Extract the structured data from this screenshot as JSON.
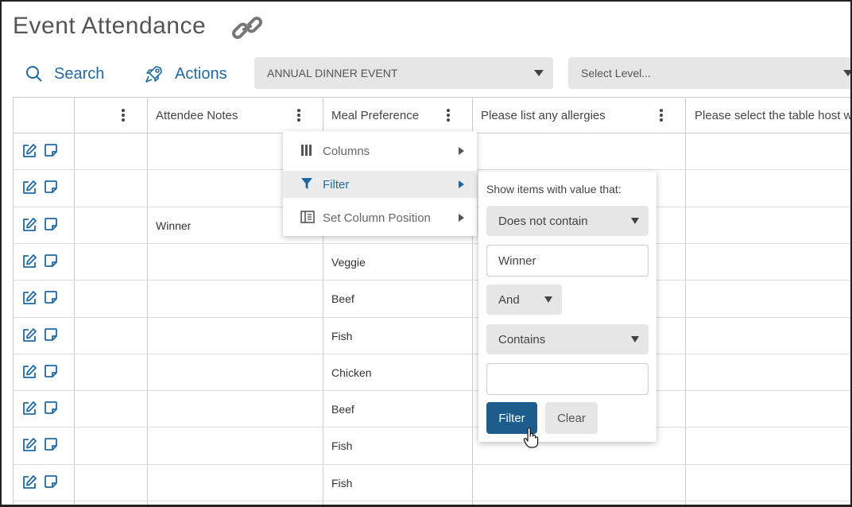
{
  "page": {
    "title": "Event Attendance"
  },
  "toolbar": {
    "search_label": "Search",
    "actions_label": "Actions",
    "event_select_value": "ANNUAL DINNER EVENT",
    "level_select_placeholder": "Select Level..."
  },
  "table": {
    "headers": [
      "",
      "Attendee Notes",
      "Meal Preference",
      "Please list any allergies",
      "Please select the table host w"
    ],
    "rows": [
      {
        "notes": "",
        "meal": ""
      },
      {
        "notes": "",
        "meal": ""
      },
      {
        "notes": "Winner",
        "meal": ""
      },
      {
        "notes": "",
        "meal": "Veggie"
      },
      {
        "notes": "",
        "meal": "Beef"
      },
      {
        "notes": "",
        "meal": "Fish"
      },
      {
        "notes": "",
        "meal": "Chicken"
      },
      {
        "notes": "",
        "meal": "Beef"
      },
      {
        "notes": "",
        "meal": "Fish"
      },
      {
        "notes": "",
        "meal": "Fish"
      }
    ]
  },
  "column_menu": {
    "items": [
      {
        "label": "Columns",
        "icon": "columns-icon"
      },
      {
        "label": "Filter",
        "icon": "filter-icon"
      },
      {
        "label": "Set Column Position",
        "icon": "column-position-icon"
      }
    ],
    "active_item": "Filter"
  },
  "filter_panel": {
    "label": "Show items with value that:",
    "condition1": "Does not contain",
    "value1": "Winner",
    "logic": "And",
    "condition2": "Contains",
    "value2": "",
    "filter_button": "Filter",
    "clear_button": "Clear"
  },
  "colors": {
    "accent": "#1f6aa5",
    "primary_button": "#1d5d8e",
    "select_bg": "#e6e6e6"
  }
}
